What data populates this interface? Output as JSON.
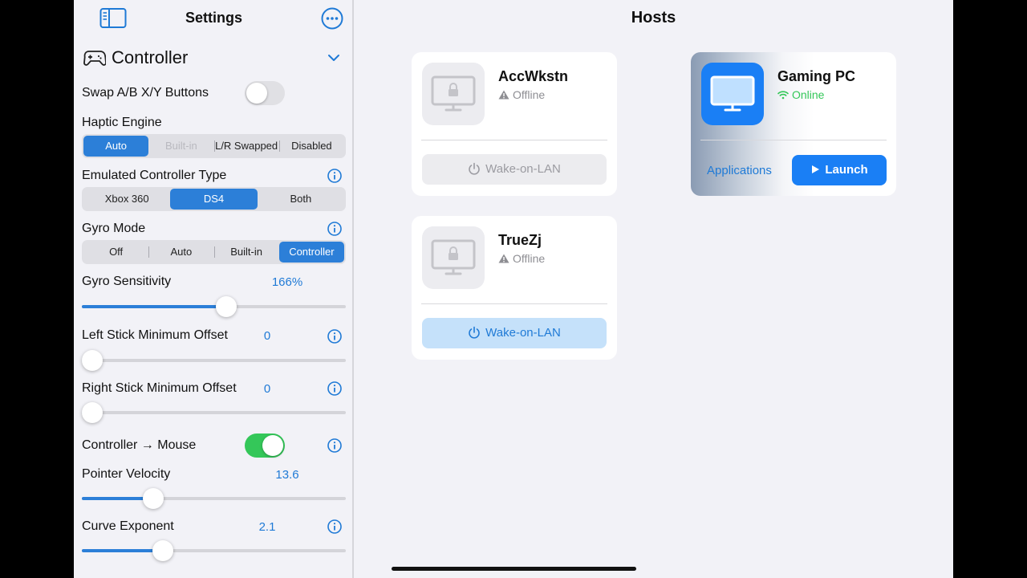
{
  "sidebar": {
    "title": "Settings",
    "section": {
      "title": "Controller"
    },
    "swap_ab": {
      "label": "Swap A/B X/Y Buttons",
      "on": false
    },
    "haptic": {
      "label": "Haptic Engine",
      "options": [
        "Auto",
        "Built-in",
        "L/R Swapped",
        "Disabled"
      ],
      "selected": "Auto",
      "disabled": [
        "Built-in"
      ]
    },
    "emulated": {
      "label": "Emulated Controller Type",
      "options": [
        "Xbox 360",
        "DS4",
        "Both"
      ],
      "selected": "DS4"
    },
    "gyro_mode": {
      "label": "Gyro Mode",
      "options": [
        "Off",
        "Auto",
        "Built-in",
        "Controller"
      ],
      "selected": "Controller"
    },
    "gyro_sensitivity": {
      "label": "Gyro Sensitivity",
      "value": "166%",
      "fraction": 0.55
    },
    "left_stick": {
      "label": "Left Stick Minimum Offset",
      "value": "0",
      "fraction": 0.0
    },
    "right_stick": {
      "label": "Right Stick Minimum Offset",
      "value": "0",
      "fraction": 0.0
    },
    "controller_mouse": {
      "label": "Controller → Mouse",
      "on": true
    },
    "pointer_velocity": {
      "label": "Pointer Velocity",
      "value": "13.6",
      "fraction": 0.25
    },
    "curve_exponent": {
      "label": "Curve Exponent",
      "value": "2.1",
      "fraction": 0.29
    }
  },
  "hosts": {
    "title": "Hosts",
    "items": [
      {
        "name": "AccWkstn",
        "status": "Offline",
        "button": "Wake-on-LAN",
        "button_active": false
      },
      {
        "name": "TrueZj",
        "status": "Offline",
        "button": "Wake-on-LAN",
        "button_active": true
      },
      {
        "name": "Gaming PC",
        "status": "Online",
        "applications": "Applications",
        "launch": "Launch"
      }
    ]
  },
  "colors": {
    "accent": "#1f7ad6",
    "online": "#34c759",
    "segment_selected": "#2c7fd8"
  }
}
